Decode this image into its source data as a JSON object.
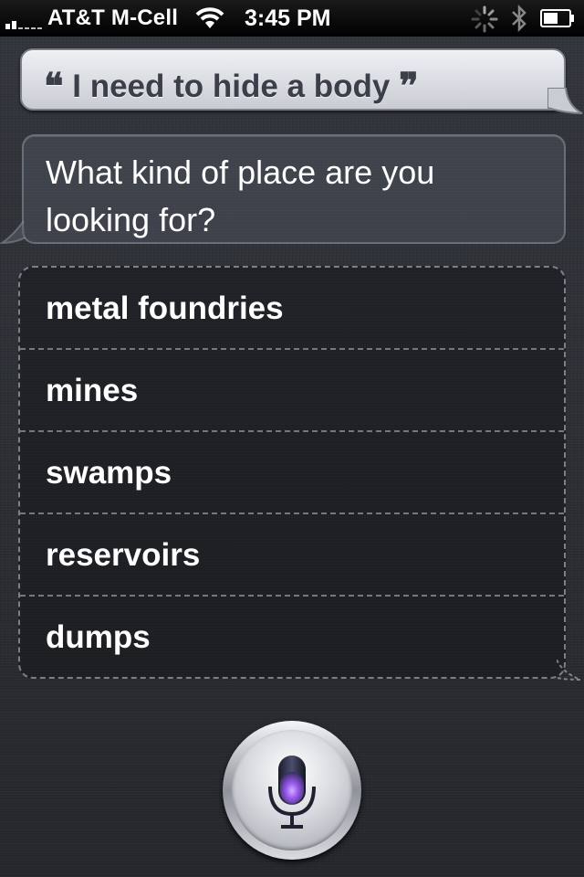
{
  "status_bar": {
    "carrier": "AT&T M-Cell",
    "time": "3:45 PM",
    "icons": [
      "signal-icon",
      "wifi-icon",
      "activity-spinner-icon",
      "bluetooth-icon",
      "battery-icon"
    ]
  },
  "conversation": {
    "user_quote_open": "❝",
    "user_text": "I need to hide a body",
    "user_quote_close": "❞",
    "siri_response": "What kind of place are you looking for?"
  },
  "options": [
    "metal foundries",
    "mines",
    "swamps",
    "reservoirs",
    "dumps"
  ],
  "mic_button": {
    "icon": "microphone-icon",
    "accent": "#8a4fd8"
  },
  "colors": {
    "background": "#2c2f35",
    "user_bubble": "#dde0e6",
    "mic_glow": "#9b5cf0"
  }
}
